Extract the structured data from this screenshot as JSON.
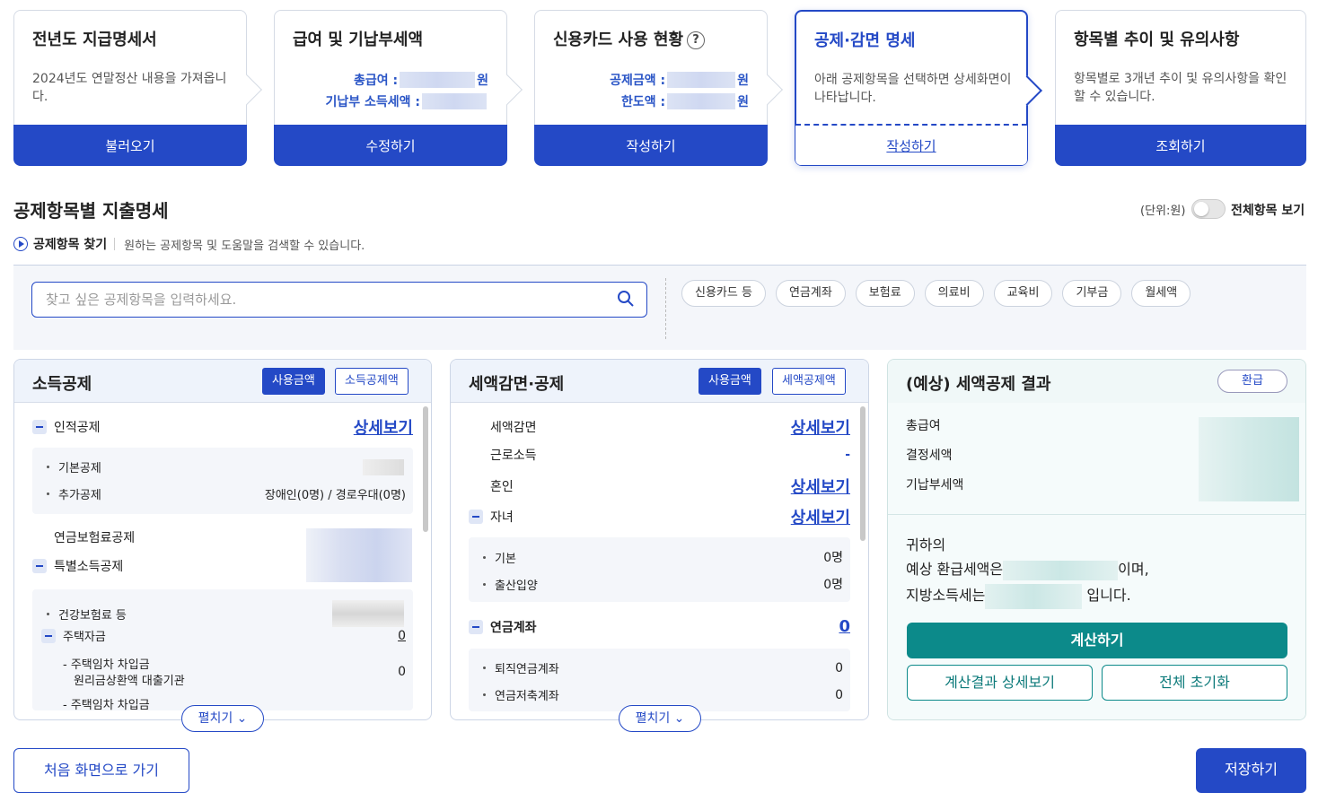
{
  "steps": [
    {
      "title": "전년도 지급명세서",
      "desc": "2024년도 연말정산 내용을 가져옵니다.",
      "button": "불러오기"
    },
    {
      "title": "급여 및 기납부세액",
      "kv1_label": "총급여 :",
      "kv1_unit": "원",
      "kv2_label": "기납부 소득세액 :",
      "kv2_unit": "원",
      "button": "수정하기"
    },
    {
      "title": "신용카드 사용 현황",
      "help": "?",
      "kv1_label": "공제금액 :",
      "kv1_unit": "원",
      "kv2_label": "한도액 :",
      "kv2_unit": "원",
      "button": "작성하기"
    },
    {
      "title": "공제·감면 명세",
      "desc": "아래 공제항목을 선택하면 상세화면이 나타납니다.",
      "button": "작성하기"
    },
    {
      "title": "항목별 추이 및 유의사항",
      "desc": "항목별로 3개년 추이 및 유의사항을 확인할 수 있습니다.",
      "button": "조회하기"
    }
  ],
  "section": {
    "title": "공제항목별 지출명세",
    "unit": "(단위:원)",
    "toggle_label": "전체항목 보기",
    "finder_label": "공제항목 찾기",
    "finder_hint": "원하는 공제항목 및 도움말을 검색할 수 있습니다."
  },
  "search": {
    "placeholder": "찾고 싶은 공제항목을 입력하세요."
  },
  "chips": [
    "신용카드 등",
    "연금계좌",
    "보험료",
    "의료비",
    "교육비",
    "기부금",
    "월세액"
  ],
  "income": {
    "title": "소득공제",
    "btn_on": "사용금액",
    "btn_off": "소득공제액",
    "personal": "인적공제",
    "detail": "상세보기",
    "basic": "기본공제",
    "extra": "추가공제",
    "extra_val": "장애인(0명) / 경로우대(0명)",
    "pension": "연금보험료공제",
    "special": "특별소득공제",
    "health": "건강보험료 등",
    "housing": "주택자금",
    "housing_val": "0",
    "loan1": "- 주택임차 차입금",
    "loan1b": "원리금상환액 대출기관",
    "loan1_val": "0",
    "loan2": "- 주택임차 차입금",
    "expand": "펼치기"
  },
  "tax": {
    "title": "세액감면·공제",
    "btn_on": "사용금액",
    "btn_off": "세액공제액",
    "reduce": "세액감면",
    "detail": "상세보기",
    "work": "근로소득",
    "work_val": "-",
    "marriage": "혼인",
    "child": "자녀",
    "c_basic": "기본",
    "c_basic_val": "0명",
    "c_birth": "출산입양",
    "c_birth_val": "0명",
    "pension": "연금계좌",
    "pension_val": "0",
    "retire": "퇴직연금계좌",
    "retire_val": "0",
    "savings": "연금저축계좌",
    "savings_val": "0",
    "expand": "펼치기"
  },
  "result": {
    "title": "(예상) 세액공제 결과",
    "badge": "환급",
    "total": "총급여",
    "decided": "결정세액",
    "prepaid": "기납부세액",
    "line1": "귀하의",
    "line2a": "예상 환급세액은",
    "line2b": "이며,",
    "line3a": "지방소득세는",
    "line3b": "입니다.",
    "calc": "계산하기",
    "detail_btn": "계산결과 상세보기",
    "reset_btn": "전체 초기화"
  },
  "footer": {
    "home": "처음 화면으로 가기",
    "save": "저장하기"
  },
  "colors": {
    "primary": "#2449c6",
    "teal": "#0c8a8a"
  }
}
